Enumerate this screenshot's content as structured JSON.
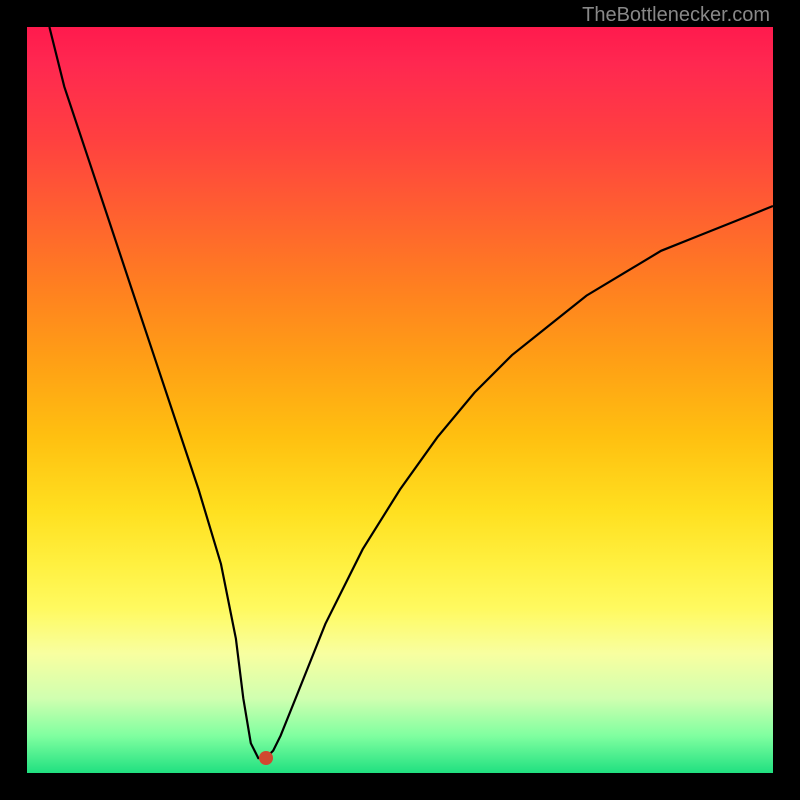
{
  "attribution": "TheBottlenecker.com",
  "chart_data": {
    "type": "line",
    "title": "",
    "xlabel": "",
    "ylabel": "",
    "xlim": [
      0,
      100
    ],
    "ylim": [
      0,
      100
    ],
    "background": "gradient-red-to-green",
    "series": [
      {
        "name": "bottleneck-curve",
        "x": [
          3,
          5,
          8,
          11,
          14,
          17,
          20,
          23,
          26,
          28,
          29,
          30,
          31,
          32,
          33,
          34,
          36,
          40,
          45,
          50,
          55,
          60,
          65,
          70,
          75,
          80,
          85,
          90,
          95,
          100
        ],
        "y": [
          100,
          92,
          83,
          74,
          65,
          56,
          47,
          38,
          28,
          18,
          10,
          4,
          2,
          2,
          3,
          5,
          10,
          20,
          30,
          38,
          45,
          51,
          56,
          60,
          64,
          67,
          70,
          72,
          74,
          76
        ]
      }
    ],
    "marker": {
      "x": 32,
      "y": 2,
      "color": "#d04830"
    }
  }
}
